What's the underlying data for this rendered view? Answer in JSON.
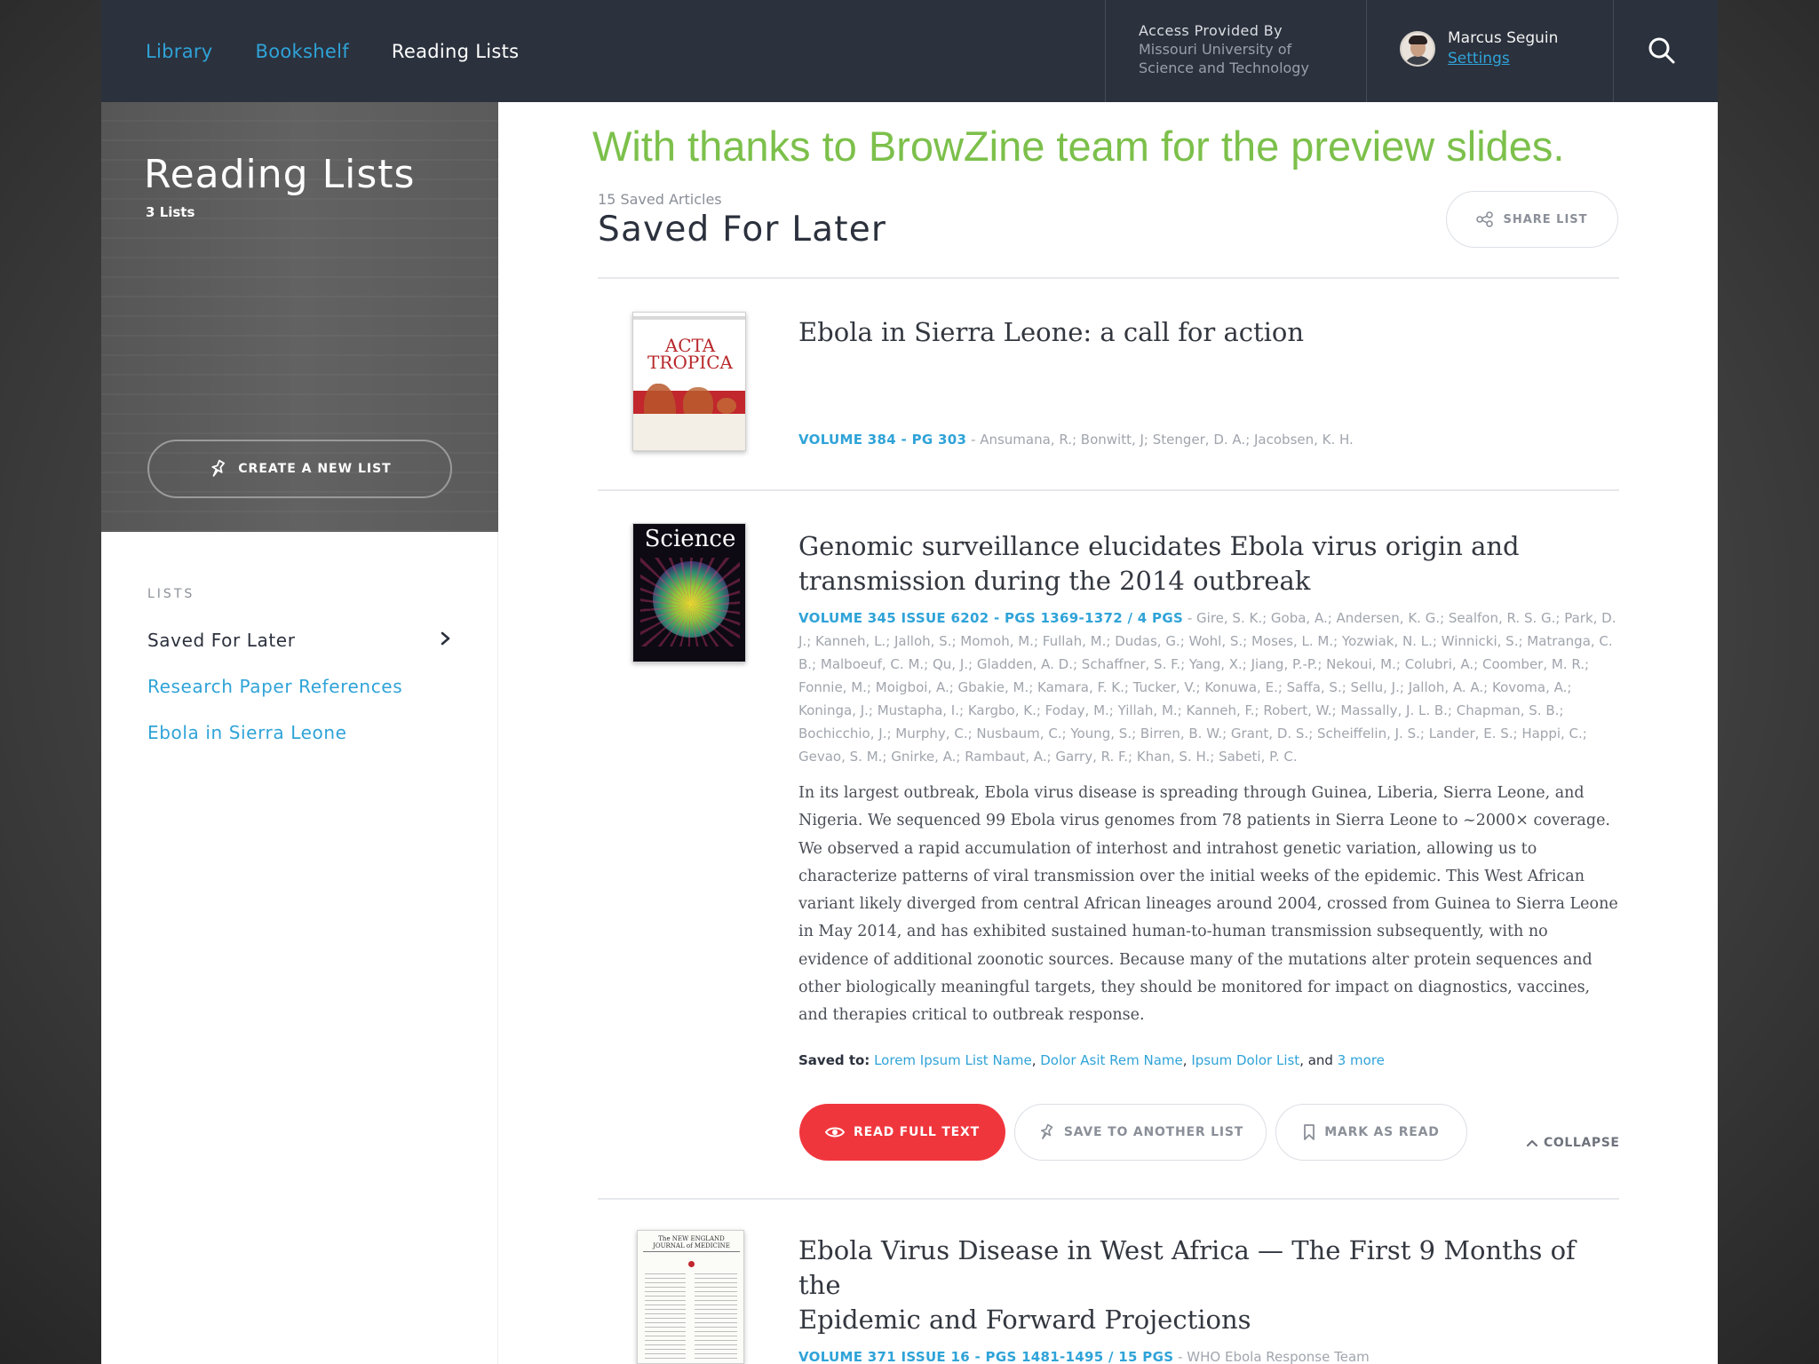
{
  "nav": {
    "library": "Library",
    "bookshelf": "Bookshelf",
    "reading_lists": "Reading Lists"
  },
  "access": {
    "label": "Access Provided By",
    "institution_line1": "Missouri University of",
    "institution_line2": "Science and Technology"
  },
  "user": {
    "name": "Marcus Seguin",
    "settings": "Settings"
  },
  "sidebar": {
    "title": "Reading Lists",
    "count": "3 Lists",
    "create_button": "CREATE A NEW LIST",
    "lists_heading": "LISTS",
    "items": [
      {
        "label": "Saved For Later"
      },
      {
        "label": "Research Paper References"
      },
      {
        "label": "Ebola in Sierra Leone"
      }
    ]
  },
  "overlay": {
    "thanks": "With thanks to BrowZine team for the preview slides."
  },
  "main": {
    "saved_count": "15 Saved Articles",
    "title": "Saved For Later",
    "share_button": "SHARE LIST",
    "articles": [
      {
        "title": "Ebola in Sierra Leone: a call for action",
        "volume": "VOLUME 384 - PG 303",
        "authors": "Ansumana, R.; Bonwitt, J; Stenger, D. A.; Jacobsen, K. H.",
        "cover": {
          "line1": "ACTA",
          "line2": "TROPICA"
        }
      },
      {
        "title_line1": "Genomic surveillance elucidates Ebola virus origin and",
        "title_line2": "transmission during the 2014 outbreak",
        "volume": "VOLUME 345 ISSUE 6202 - PGS 1369-1372 / 4 PGS",
        "authors": "Gire, S. K.; Goba, A.; Andersen, K. G.; Sealfon, R. S. G.; Park, D. J.; Kanneh, L.; Jalloh, S.; Momoh, M.; Fullah, M.; Dudas, G.; Wohl, S.; Moses, L. M.; Yozwiak, N. L.; Winnicki, S.; Matranga, C. B.; Malboeuf, C. M.; Qu, J.; Gladden, A. D.; Schaffner, S. F.; Yang, X.; Jiang, P.-P.; Nekoui, M.; Colubri, A.; Coomber, M. R.; Fonnie, M.; Moigboi, A.; Gbakie, M.; Kamara, F. K.; Tucker, V.; Konuwa, E.; Saffa, S.; Sellu, J.; Jalloh, A. A.; Kovoma, A.; Koninga, J.; Mustapha, I.; Kargbo, K.; Foday, M.; Yillah, M.; Kanneh, F.; Robert, W.; Massally, J. L. B.; Chapman, S. B.; Bochicchio, J.; Murphy, C.; Nusbaum, C.; Young, S.; Birren, B. W.; Grant, D. S.; Scheiffelin, J. S.; Lander, E. S.; Happi, C.; Gevao, S. M.; Gnirke, A.; Rambaut, A.; Garry, R. F.; Khan, S. H.; Sabeti, P. C.",
        "abstract": "In its largest outbreak, Ebola virus disease is spreading through Guinea, Liberia, Sierra Leone, and Nigeria. We sequenced 99 Ebola virus genomes from 78 patients in Sierra Leone to ~2000× coverage. We observed a rapid accumulation of interhost and intrahost genetic variation, allowing us to characterize patterns of viral transmission over the initial weeks of the epidemic. This West African variant likely diverged from central African lineages around 2004, crossed from Guinea to Sierra Leone in May 2014, and has exhibited sustained human-to-human transmission subsequently, with no evidence of additional zoonotic sources. Because many of the mutations alter protein sequences and other biologically meaningful targets, they should be monitored for impact on diagnostics, vaccines, and therapies critical to outbreak response.",
        "saved_to_label": "Saved to:",
        "saved_to_lists": [
          "Lorem Ipsum List Name",
          "Dolor Asit Rem Name",
          "Ipsum Dolor List"
        ],
        "saved_to_and": ", and",
        "saved_to_more": "3 more",
        "cover": {
          "masthead": "Science"
        },
        "buttons": {
          "read": "READ FULL TEXT",
          "save": "SAVE TO ANOTHER LIST",
          "mark": "MARK AS READ",
          "collapse": "COLLAPSE"
        }
      },
      {
        "title_line1": "Ebola Virus Disease in West Africa — The First 9 Months of the",
        "title_line2": "Epidemic and Forward Projections",
        "volume": "VOLUME 371 ISSUE 16 - PGS 1481-1495 / 15 PGS",
        "authors": "WHO Ebola Response Team",
        "cover": {
          "masthead": "The NEW ENGLAND JOURNAL of MEDICINE"
        }
      }
    ]
  },
  "colors": {
    "accent": "#2fa3d8",
    "topbar": "#2b313d",
    "read_button": "#f0363d",
    "overlay_text": "#7cc04b"
  }
}
